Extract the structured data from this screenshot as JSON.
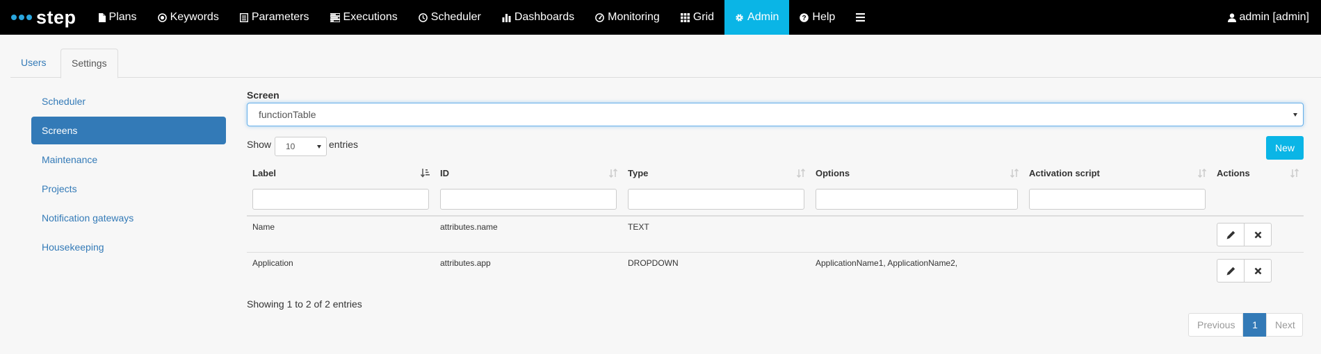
{
  "brand": {
    "name": "step",
    "accent": "#2aa6de"
  },
  "nav": {
    "items": [
      {
        "label": "Plans",
        "icon": "file-icon"
      },
      {
        "label": "Keywords",
        "icon": "record-icon"
      },
      {
        "label": "Parameters",
        "icon": "list-alt-icon"
      },
      {
        "label": "Executions",
        "icon": "tasks-icon"
      },
      {
        "label": "Scheduler",
        "icon": "clock-icon"
      },
      {
        "label": "Dashboards",
        "icon": "bar-chart-icon"
      },
      {
        "label": "Monitoring",
        "icon": "dashboard-icon"
      },
      {
        "label": "Grid",
        "icon": "grid-icon"
      },
      {
        "label": "Admin",
        "icon": "gear-icon",
        "active": true
      },
      {
        "label": "Help",
        "icon": "question-icon"
      }
    ],
    "menu_icon": "hamburger-icon",
    "user": "admin [admin]",
    "active_color": "#0ab5e6"
  },
  "tabs": {
    "users": "Users",
    "settings": "Settings"
  },
  "settings_menu": {
    "items": [
      "Scheduler",
      "Screens",
      "Maintenance",
      "Projects",
      "Notification gateways",
      "Housekeeping"
    ],
    "active": "Screens"
  },
  "screen": {
    "label": "Screen",
    "value": "functionTable"
  },
  "table_controls": {
    "show": "Show",
    "entries_value": "10",
    "entries": "entries",
    "new_label": "New"
  },
  "table": {
    "columns": [
      "Label",
      "ID",
      "Type",
      "Options",
      "Activation script",
      "Actions"
    ],
    "rows": [
      {
        "label": "Name",
        "id": "attributes.name",
        "type": "TEXT",
        "options": "",
        "script": ""
      },
      {
        "label": "Application",
        "id": "attributes.app",
        "type": "DROPDOWN",
        "options": "ApplicationName1, ApplicationName2,",
        "script": ""
      }
    ]
  },
  "footer": {
    "info": "Showing 1 to 2 of 2 entries",
    "prev": "Previous",
    "page": "1",
    "next": "Next"
  }
}
